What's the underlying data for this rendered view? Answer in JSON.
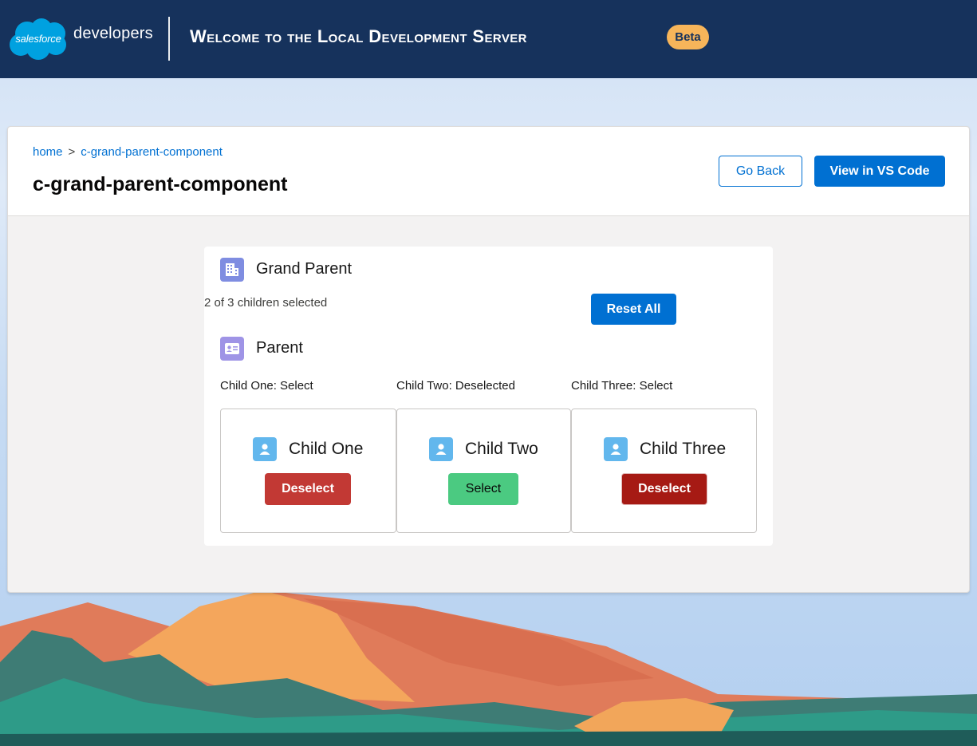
{
  "header": {
    "logo_cloud": "salesforce",
    "logo_text": "developers",
    "welcome": "Welcome to the Local Development Server",
    "badge": "Beta"
  },
  "breadcrumb": {
    "home": "home",
    "separator": ">",
    "current": "c-grand-parent-component"
  },
  "page": {
    "title": "c-grand-parent-component",
    "go_back": "Go Back",
    "view_vscode": "View in VS Code"
  },
  "grandparent": {
    "title": "Grand Parent",
    "selection_text": "2 of 3 children selected",
    "reset_label": "Reset All",
    "icon": "building-icon"
  },
  "parent": {
    "title": "Parent",
    "icon": "contact-card-icon",
    "statuses": [
      "Child One: Select",
      "Child Two: Deselected",
      "Child Three: Select"
    ],
    "children": [
      {
        "name": "Child One",
        "button": "Deselect",
        "icon": "user-icon"
      },
      {
        "name": "Child Two",
        "button": "Select",
        "icon": "user-icon"
      },
      {
        "name": "Child Three",
        "button": "Deselect",
        "icon": "user-icon"
      }
    ]
  },
  "colors": {
    "brand_navy": "#16325c",
    "brand_blue": "#0070d2",
    "beta": "#f7b55a",
    "deselect": "#c23934",
    "deselect_focused": "#a61a14",
    "select": "#4bca81"
  }
}
